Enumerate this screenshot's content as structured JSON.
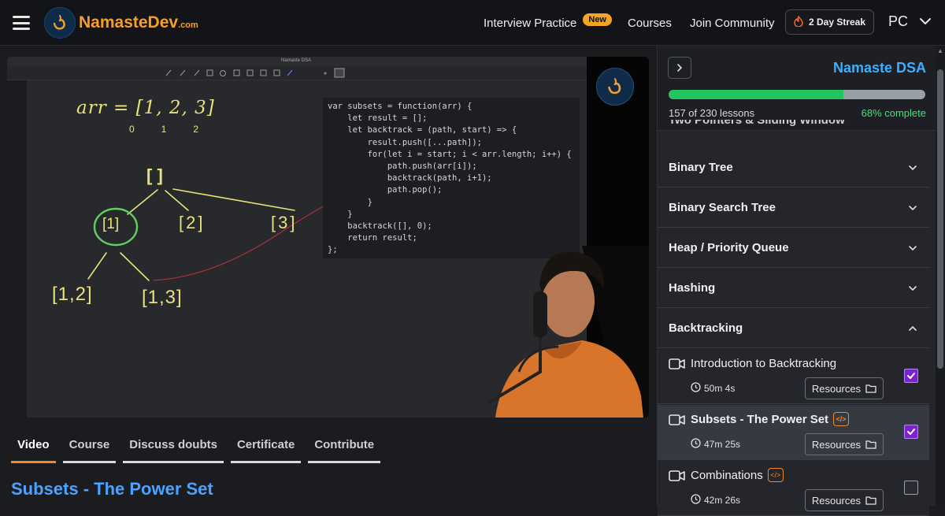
{
  "header": {
    "logo_text": "NamasteDev",
    "logo_suffix": ".com",
    "nav": {
      "interview": "Interview Practice",
      "new_badge": "New",
      "courses": "Courses",
      "community": "Join Community"
    },
    "streak": "2 Day Streak",
    "user_initials": "PC"
  },
  "video": {
    "whiteboard_title": "Namaste DSA",
    "code_lines": [
      "var subsets = function(arr) {",
      "    let result = [];",
      "    let backtrack = (path, start) => {",
      "        result.push([...path]);",
      "        for(let i = start; i < arr.length; i++) {",
      "            path.push(arr[i]);",
      "            backtrack(path, i+1);",
      "            path.pop();",
      "        }",
      "    }",
      "    backtrack([], 0);",
      "    return result;",
      "};"
    ],
    "handwriting": {
      "arr": "arr = [1, 2, 3]",
      "indices": "0   1   2",
      "root": "[ ]",
      "n1": "[1]",
      "n2": "[2]",
      "n3": "[3]",
      "n12": "[1,2]",
      "n13": "[1,3]"
    }
  },
  "tabs": [
    "Video",
    "Course",
    "Discuss doubts",
    "Certificate",
    "Contribute"
  ],
  "active_tab": "Video",
  "lesson_title": "Subsets - The Power Set",
  "panel": {
    "course_name": "Namaste DSA",
    "progress_fraction": 0.68,
    "lessons_count": "157 of 230 lessons",
    "complete_pct": "68% complete",
    "cut_section": "Two Pointers & Sliding Window",
    "sections": [
      "Binary Tree",
      "Binary Search Tree",
      "Heap / Priority Queue",
      "Hashing",
      "Backtracking"
    ],
    "lessons": [
      {
        "name": "Introduction to Backtracking",
        "duration": "50m 4s",
        "resources": "Resources",
        "completed": true,
        "code_tag": false
      },
      {
        "name": "Subsets - The Power Set",
        "duration": "47m 25s",
        "resources": "Resources",
        "completed": true,
        "code_tag": true
      },
      {
        "name": "Combinations",
        "duration": "42m 26s",
        "resources": "Resources",
        "completed": false,
        "code_tag": true
      }
    ]
  },
  "colors": {
    "accent_orange": "#f08a2a",
    "brand_blue": "#3cb0ff",
    "progress_green": "#22c55e",
    "check_purple": "#7e22ce"
  }
}
